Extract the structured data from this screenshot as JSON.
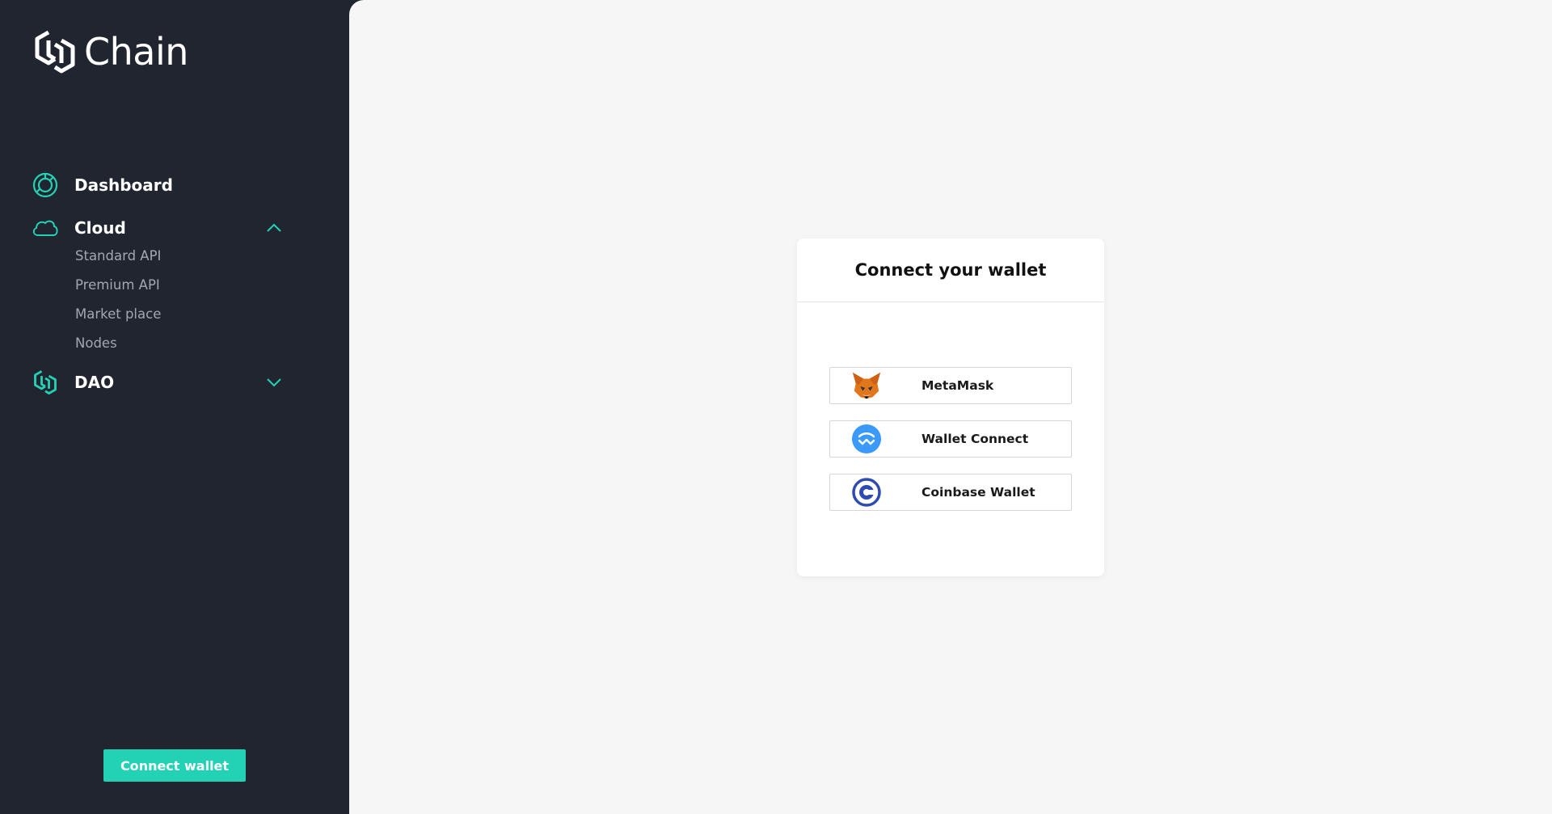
{
  "brand": {
    "name": "Chain",
    "accent": "#23d2b5",
    "sidebar_bg": "#202530"
  },
  "sidebar": {
    "items": [
      {
        "label": "Dashboard",
        "icon": "dashboard-icon"
      },
      {
        "label": "Cloud",
        "icon": "cloud-icon",
        "expanded": true,
        "children": [
          "Standard API",
          "Premium API",
          "Market place",
          "Nodes"
        ]
      },
      {
        "label": "DAO",
        "icon": "dao-icon",
        "expanded": false
      }
    ],
    "connect_label": "Connect wallet"
  },
  "modal": {
    "title": "Connect your wallet",
    "wallets": [
      {
        "label": "MetaMask",
        "icon": "metamask-fox-icon"
      },
      {
        "label": "Wallet Connect",
        "icon": "walletconnect-icon"
      },
      {
        "label": "Coinbase Wallet",
        "icon": "coinbase-icon"
      }
    ]
  }
}
